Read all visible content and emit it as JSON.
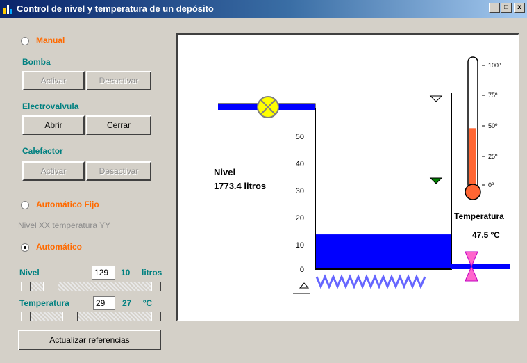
{
  "window": {
    "title": "Control de nivel y temperatura de un depósito",
    "min": "_",
    "max": "□",
    "close": "x"
  },
  "manual": {
    "label": "Manual",
    "selected": false
  },
  "bomba": {
    "label": "Bomba",
    "activar": "Activar",
    "desactivar": "Desactivar"
  },
  "electrovalvula": {
    "label": "Electrovalvula",
    "abrir": "Abrir",
    "cerrar": "Cerrar"
  },
  "calefactor": {
    "label": "Calefactor",
    "activar": "Activar",
    "desactivar": "Desactivar"
  },
  "automatico_fijo": {
    "label": "Automático Fijo",
    "selected": false,
    "info": "Nivel XX temperatura YY"
  },
  "automatico": {
    "label": "Automático",
    "selected": true
  },
  "nivel": {
    "label": "Nivel",
    "input": "129",
    "value": "10",
    "unit": "litros",
    "slider_fraction": 0.12
  },
  "temperatura": {
    "label": "Temperatura",
    "input": "29",
    "value": "27",
    "unit": "ºC",
    "slider_fraction": 0.3
  },
  "update_button": "Actualizar referencias",
  "display": {
    "nivel_label": "Nivel",
    "nivel_value": "1773.4 litros",
    "temperatura_label": "Temperatura",
    "temperatura_value": "47.5 ºC",
    "scale_ticks": [
      "50",
      "40",
      "30",
      "20",
      "10",
      "0"
    ],
    "thermo_ticks": [
      "100º",
      "75º",
      "50º",
      "25º",
      "0º"
    ],
    "tank_level": 13,
    "thermo_level": 47.5,
    "colors": {
      "water": "#0000ff",
      "mercury": "#ff6633",
      "valve": "#ffff00",
      "drain_valve": "#ff66cc",
      "heater": "#6666ff",
      "marker": "#008000"
    }
  }
}
